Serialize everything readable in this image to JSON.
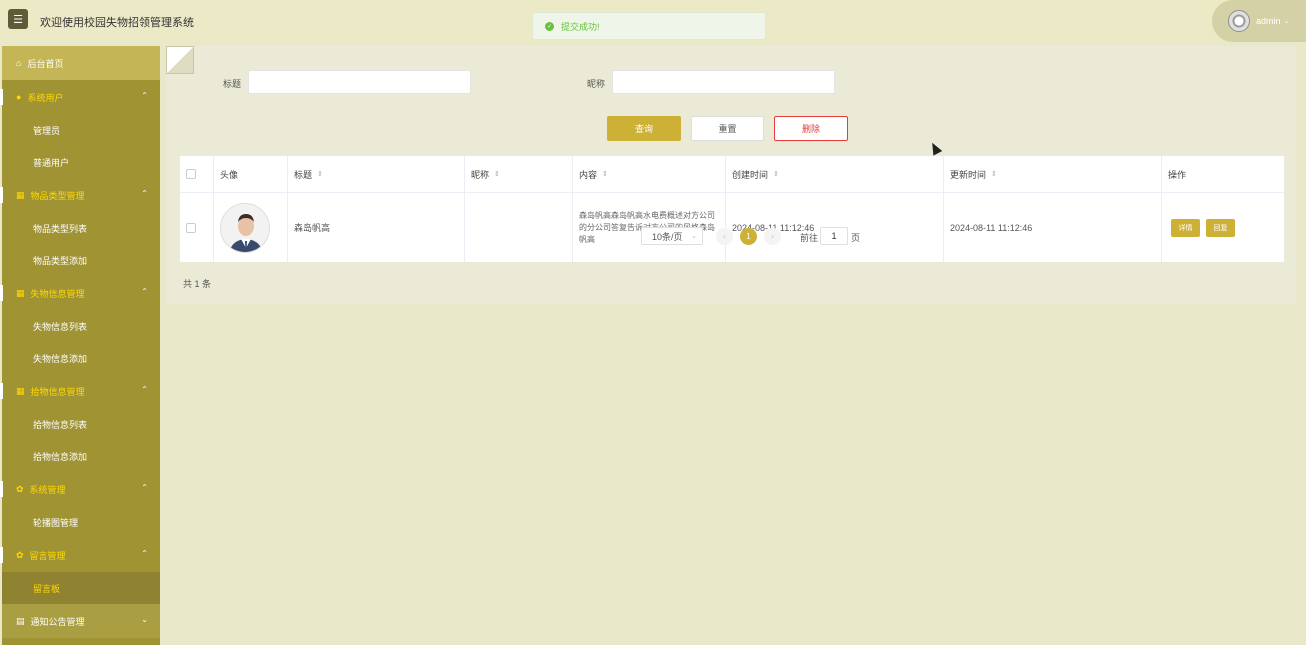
{
  "header": {
    "menu_icon": "hamburger-icon",
    "title": "欢迎使用校园失物招领管理系统",
    "toast": "提交成功!",
    "username": "admin"
  },
  "sidebar": {
    "home": "后台首页",
    "groups": [
      {
        "label": "系统用户",
        "icon": "user-icon",
        "items": [
          "管理员",
          "普通用户"
        ]
      },
      {
        "label": "物品类型管理",
        "icon": "grid-icon",
        "items": [
          "物品类型列表",
          "物品类型添加"
        ]
      },
      {
        "label": "失物信息管理",
        "icon": "grid-icon",
        "items": [
          "失物信息列表",
          "失物信息添加"
        ]
      },
      {
        "label": "拾物信息管理",
        "icon": "grid-icon",
        "items": [
          "拾物信息列表",
          "拾物信息添加"
        ]
      },
      {
        "label": "系统管理",
        "icon": "gear-icon",
        "items": [
          "轮播图管理"
        ]
      },
      {
        "label": "留言管理",
        "icon": "gear-icon",
        "items": [
          "留言板"
        ]
      },
      {
        "label": "通知公告管理",
        "icon": "doc-icon",
        "items": []
      }
    ]
  },
  "search": {
    "title_label": "标题",
    "title_value": "",
    "nickname_label": "昵称",
    "nickname_value": "",
    "query_button": "查询",
    "reset_button": "重置",
    "delete_button": "删除"
  },
  "table": {
    "headers": [
      "头像",
      "标题",
      "昵称",
      "内容",
      "创建时间",
      "更新时间",
      "操作"
    ],
    "rows": [
      {
        "title": "森岛帆高",
        "nickname": "",
        "content": "森岛帆高森岛帆高水电费概述对方公司的分公司答复告诉对方公司的风格森岛帆高",
        "created": "2024-08-11 11:12:46",
        "updated": "2024-08-11 11:12:46",
        "detail_button": "详情",
        "reply_button": "回复"
      }
    ]
  },
  "pagination": {
    "total": "共 1 条",
    "page_size": "10条/页",
    "current_page": "1",
    "goto_prefix": "前往",
    "goto_value": "1",
    "goto_suffix": "页"
  }
}
